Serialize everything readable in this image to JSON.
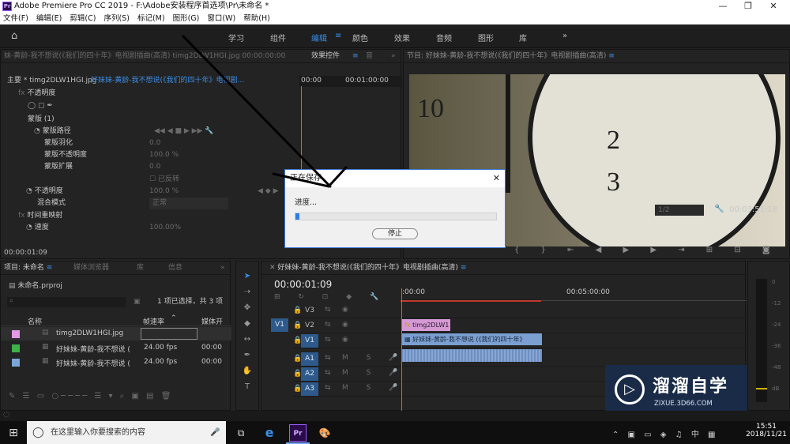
{
  "window": {
    "title": "Adobe Premiere Pro CC 2019 - F:\\Adobe安装程序首选项\\Pr\\未命名 *",
    "minimize": "—",
    "maximize": "❐",
    "close": "✕"
  },
  "menu": [
    "文件(F)",
    "编辑(E)",
    "剪辑(C)",
    "序列(S)",
    "标记(M)",
    "图形(G)",
    "窗口(W)",
    "帮助(H)"
  ],
  "workspaces": {
    "home": "⌂",
    "items": [
      "学习",
      "组件",
      "编辑",
      "颜色",
      "效果",
      "音频",
      "图形",
      "库"
    ],
    "active": "编辑",
    "more": "»"
  },
  "effect_panel": {
    "tab_source": "妹-黄龄-我不想说(《我们的四十年》电视剧插曲(高清)  timg2DLW1HGI.jpg  00:00:00:00",
    "tab_effect_controls": "效果控件",
    "tab_other": "音",
    "header_left": "主要 * timg2DLW1HGI.jpg",
    "header_right": "好妹妹-黄龄-我不想说(《我们的四十年》电视剧...",
    "time_a": "00:00",
    "time_b": "00:01:00:00",
    "opacity": "不透明度",
    "mask": "蒙版 (1)",
    "mask_path": "蒙版路径",
    "mask_feather": "蒙版羽化",
    "mask_feather_val": "0.0",
    "mask_opacity": "蒙版不透明度",
    "mask_opacity_val": "100.0 %",
    "mask_expansion": "蒙版扩展",
    "mask_expansion_val": "0.0",
    "inverted": "已反转",
    "opacity2": "不透明度",
    "opacity2_val": "100.0 %",
    "blend_mode": "混合模式",
    "blend_mode_val": "正常",
    "time_remap": "时间重映射",
    "speed": "速度",
    "speed_val": "100.00%",
    "timecode": "00:00:01:09"
  },
  "program": {
    "tab": "节目: 好妹妹-黄龄-我不想说(《我们的四十年》电视剧插曲(高清)",
    "zoom": "1/2",
    "timecode": "00:03:51:18",
    "clock_digits": [
      "10",
      "2",
      "3"
    ]
  },
  "dialog": {
    "title": "正在保存",
    "progress_label": "进度...",
    "progress_fraction": 0.02,
    "stop_button": "停止",
    "close": "✕"
  },
  "project": {
    "tab_project": "项目: 未命名",
    "tab_media": "媒体浏览器",
    "tab_library": "库",
    "tab_info": "信息",
    "project_file": "未命名.prproj",
    "selection": "1 项已选择，共 3 项",
    "col_name": "名称",
    "col_fps": "帧速率",
    "col_media": "媒体开",
    "items": [
      {
        "name": "timg2DLW1HGI.jpg",
        "fps": "",
        "media": "",
        "color": "#e59ae6"
      },
      {
        "name": "好妹妹-黄龄-我不想说 (",
        "fps": "24.00 fps",
        "media": "00:00",
        "color": "#3fb24a"
      },
      {
        "name": "好妹妹-黄龄-我不想说 (",
        "fps": "24.00 fps",
        "media": "00:00",
        "color": "#7aa7d8"
      }
    ]
  },
  "timeline": {
    "tab": "好妹妹-黄龄-我不想说(《我们的四十年》电视剧插曲(高清)",
    "timecode": "00:00:01:09",
    "ruler": [
      ":00:00",
      "00:05:00:00"
    ],
    "tracks": [
      "V3",
      "V2",
      "V1",
      "A1",
      "A2",
      "A3"
    ],
    "source_v": "V1",
    "clip_v2": "timg2DLW1",
    "clip_v1": "好妹妹-黄龄-我不想说 (《我们的四十年》",
    "fx": "fx"
  },
  "meter": {
    "scale": [
      "0",
      "-12",
      "-24",
      "-36",
      "-48",
      "dB"
    ]
  },
  "watermark": {
    "brand": "溜溜自学",
    "url": "ZIXUE.3D66.COM"
  },
  "taskbar": {
    "search_placeholder": "在这里输入你要搜索的内容",
    "time": "15:51",
    "date": "2018/11/21"
  }
}
